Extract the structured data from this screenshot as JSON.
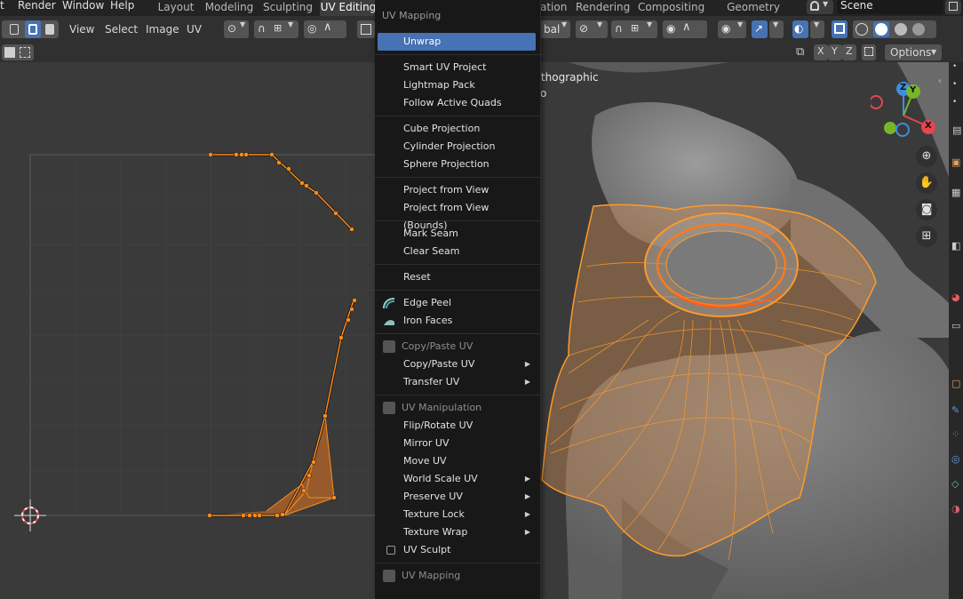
{
  "topbar": {
    "menus": [
      "t",
      "Render",
      "Window",
      "Help"
    ],
    "workspaces": [
      "Layout",
      "Modeling",
      "Sculpting",
      "UV Editing",
      "ation",
      "Rendering",
      "Compositing",
      "Geometry Nodes"
    ],
    "active_workspace": "UV Editing",
    "scene": "Scene"
  },
  "uv_header": {
    "menus": [
      "View",
      "Select",
      "Image",
      "UV"
    ]
  },
  "viewport_header": {
    "partial_text": "bal",
    "gizmo_axes": [
      "X",
      "Y",
      "Z"
    ],
    "options_label": "Options",
    "overlay_text_1": "rthographic",
    "overlay_text_2": "o"
  },
  "nav_gizmo": {
    "axes": [
      "Z",
      "Y",
      "X"
    ],
    "colors": {
      "x": "#e8454e",
      "y": "#77b62a",
      "z": "#3b8fdf"
    }
  },
  "menu": {
    "title": "UV Mapping",
    "items": [
      {
        "label": "Unwrap",
        "highlighted": true
      },
      {
        "label": "Smart UV Project"
      },
      {
        "label": "Lightmap Pack"
      },
      {
        "label": "Follow Active Quads"
      },
      {
        "label": "Cube Projection"
      },
      {
        "label": "Cylinder Projection"
      },
      {
        "label": "Sphere Projection"
      },
      {
        "label": "Project from View"
      },
      {
        "label": "Project from View (Bounds)"
      },
      {
        "label": "Mark Seam"
      },
      {
        "label": "Clear Seam"
      },
      {
        "label": "Reset"
      },
      {
        "label": "Edge Peel",
        "icon": "edge-peel-icon"
      },
      {
        "label": "Iron Faces",
        "icon": "iron-icon"
      },
      {
        "label": "Copy/Paste UV",
        "section": true
      },
      {
        "label": "Copy/Paste UV",
        "submenu": true
      },
      {
        "label": "Transfer UV",
        "submenu": true
      },
      {
        "label": "UV Manipulation",
        "section": true
      },
      {
        "label": "Flip/Rotate UV"
      },
      {
        "label": "Mirror UV"
      },
      {
        "label": "Move UV"
      },
      {
        "label": "World Scale UV",
        "submenu": true
      },
      {
        "label": "Preserve UV",
        "submenu": true
      },
      {
        "label": "Texture Lock",
        "submenu": true
      },
      {
        "label": "Texture Wrap",
        "submenu": true
      },
      {
        "label": "UV Sculpt",
        "checkbox": true,
        "checked": false
      },
      {
        "label": "UV Mapping",
        "section": true
      }
    ]
  },
  "colors": {
    "accent": "#4772b3",
    "selection": "#ff8c1a",
    "uv_fill": "#c06a2a"
  }
}
